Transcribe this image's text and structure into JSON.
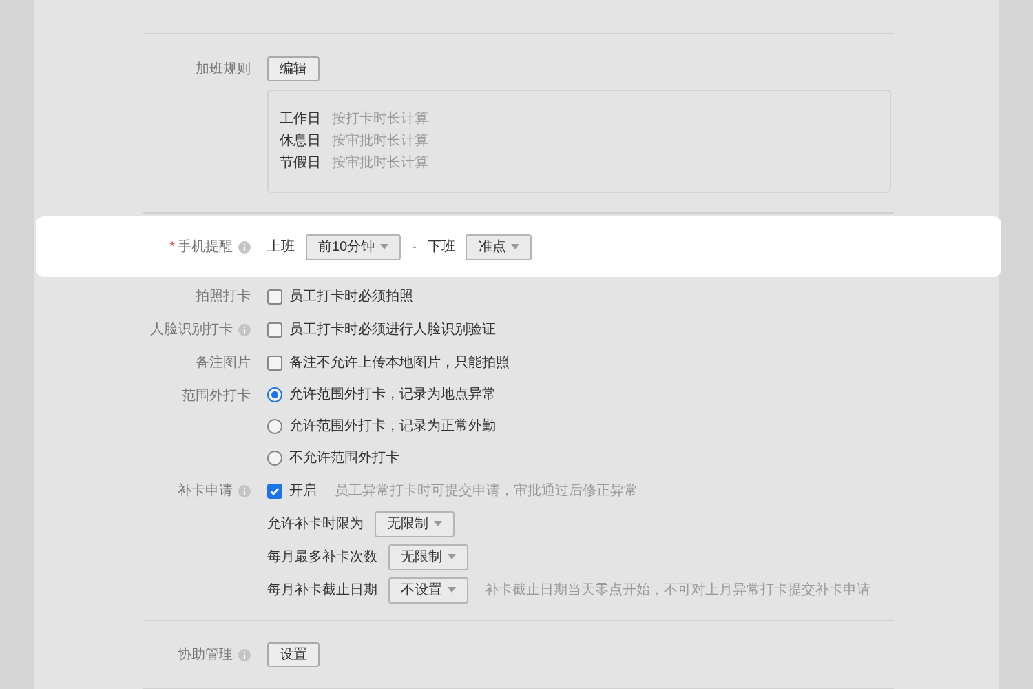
{
  "sections": [
    {
      "rows": [
        {
          "kind": "button",
          "label": "加班规则",
          "info": false,
          "highlighted": false,
          "button": "编辑",
          "rules": [
            {
              "day": "工作日",
              "rule": "按打卡时长计算"
            },
            {
              "day": "休息日",
              "rule": "按审批时长计算"
            },
            {
              "day": "节假日",
              "rule": "按审批时长计算"
            }
          ]
        }
      ]
    },
    {
      "rows": [
        {
          "kind": "selects",
          "label": "手机提醒",
          "marker": "*",
          "info": true,
          "highlighted": true,
          "items": [
            {
              "kind": "text",
              "text": "上班"
            },
            {
              "kind": "select",
              "value": "前10分钟"
            },
            {
              "kind": "text",
              "text": "-"
            },
            {
              "kind": "text",
              "text": "下班"
            },
            {
              "kind": "select",
              "value": "准点"
            }
          ]
        },
        {
          "kind": "checkbox",
          "label": "拍照打卡",
          "info": false,
          "highlighted": false,
          "checked": false,
          "text": "员工打卡时必须拍照"
        },
        {
          "kind": "checkbox",
          "label": "人脸识别打卡",
          "info": true,
          "highlighted": false,
          "checked": false,
          "text": "员工打卡时必须进行人脸识别验证"
        },
        {
          "kind": "checkbox",
          "label": "备注图片",
          "info": false,
          "highlighted": false,
          "checked": false,
          "text": "备注不允许上传本地图片，只能拍照"
        },
        {
          "kind": "radio",
          "label": "范围外打卡",
          "info": false,
          "highlighted": false,
          "options": [
            {
              "text": "允许范围外打卡，记录为地点异常",
              "selected": true
            },
            {
              "text": "允许范围外打卡，记录为正常外勤",
              "selected": false
            },
            {
              "text": "不允许范围外打卡",
              "selected": false
            }
          ]
        },
        {
          "kind": "checkbox",
          "label": "补卡申请",
          "info": true,
          "highlighted": false,
          "checked": true,
          "text": "开启",
          "hint": "员工异常打卡时可提交申请，审批通过后修正异常",
          "sub": [
            {
              "label": "允许补卡时限为",
              "value": "无限制"
            },
            {
              "label": "每月最多补卡次数",
              "value": "无限制"
            },
            {
              "label": "每月补卡截止日期",
              "value": "不设置",
              "hint": "补卡截止日期当天零点开始，不可对上月异常打卡提交补卡申请"
            }
          ]
        }
      ]
    },
    {
      "rows": [
        {
          "kind": "button",
          "label": "协助管理",
          "info": true,
          "highlighted": false,
          "button": "设置"
        }
      ]
    }
  ]
}
